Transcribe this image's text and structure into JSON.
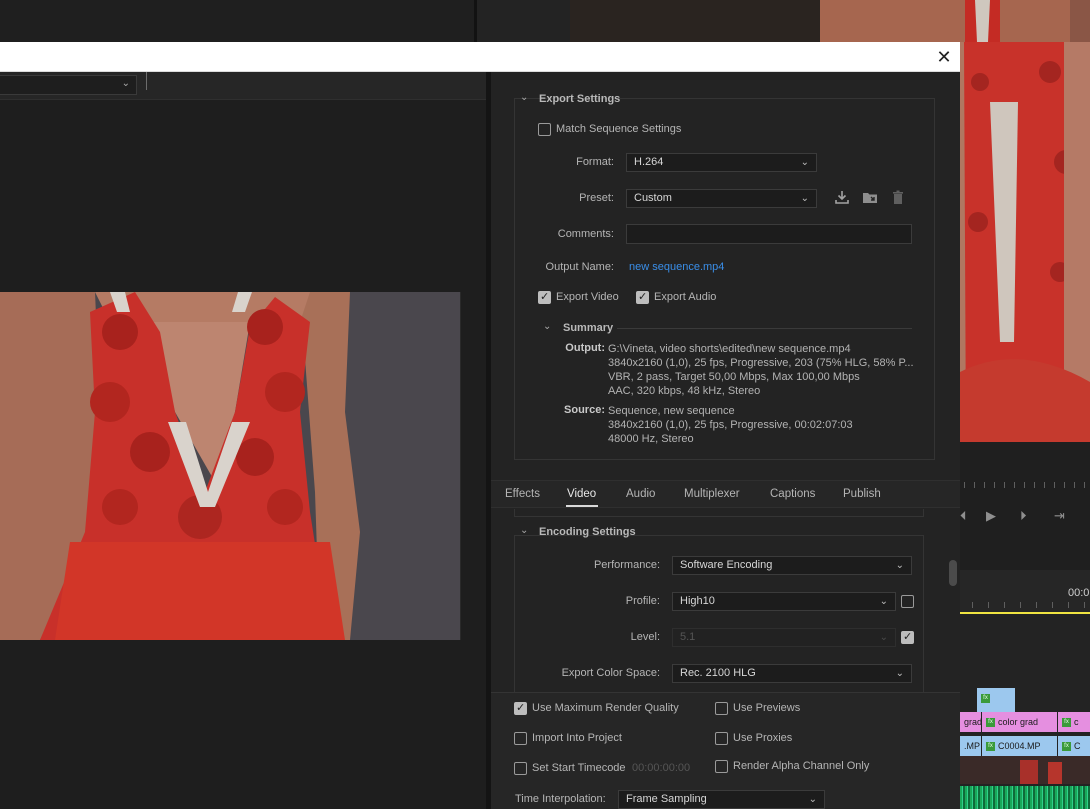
{
  "dialog": {
    "close_glyph": "✕"
  },
  "export_settings": {
    "header": "Export Settings",
    "match_sequence_label": "Match Sequence Settings",
    "match_sequence_checked": false,
    "format_label": "Format:",
    "format_value": "H.264",
    "preset_label": "Preset:",
    "preset_value": "Custom",
    "preset_icons": [
      "save-preset-icon",
      "import-preset-icon",
      "delete-preset-icon"
    ],
    "comments_label": "Comments:",
    "comments_value": "",
    "output_name_label": "Output Name:",
    "output_name_value": "new sequence.mp4",
    "export_video_label": "Export Video",
    "export_video_checked": true,
    "export_audio_label": "Export Audio",
    "export_audio_checked": true
  },
  "summary": {
    "header": "Summary",
    "output_key": "Output:",
    "output_lines": [
      "G:\\Vineta, video shorts\\edited\\new sequence.mp4",
      "3840x2160 (1,0), 25 fps, Progressive, 203 (75% HLG, 58% P...",
      "VBR, 2 pass, Target 50,00 Mbps, Max 100,00 Mbps",
      "AAC, 320 kbps, 48 kHz, Stereo"
    ],
    "source_key": "Source:",
    "source_lines": [
      "Sequence, new sequence",
      "3840x2160 (1,0), 25 fps, Progressive, 00:02:07:03",
      "48000 Hz, Stereo"
    ]
  },
  "tabs": [
    {
      "label": "Effects",
      "active": false
    },
    {
      "label": "Video",
      "active": true
    },
    {
      "label": "Audio",
      "active": false
    },
    {
      "label": "Multiplexer",
      "active": false
    },
    {
      "label": "Captions",
      "active": false
    },
    {
      "label": "Publish",
      "active": false
    }
  ],
  "encoding": {
    "header": "Encoding Settings",
    "performance_label": "Performance:",
    "performance_value": "Software Encoding",
    "profile_label": "Profile:",
    "profile_value": "High10",
    "profile_checkbox_checked": false,
    "level_label": "Level:",
    "level_value": "5.1",
    "level_checkbox_checked": true,
    "color_space_label": "Export Color Space:",
    "color_space_value": "Rec. 2100 HLG"
  },
  "bottom": {
    "use_max_render_quality_label": "Use Maximum Render Quality",
    "use_max_render_quality_checked": true,
    "use_previews_label": "Use Previews",
    "use_previews_checked": false,
    "import_into_project_label": "Import Into Project",
    "import_into_project_checked": false,
    "use_proxies_label": "Use Proxies",
    "use_proxies_checked": false,
    "set_start_timecode_label": "Set Start Timecode",
    "set_start_timecode_checked": false,
    "start_timecode_value": "00:00:00:00",
    "render_alpha_label": "Render Alpha Channel Only",
    "render_alpha_checked": false,
    "time_interpolation_label": "Time Interpolation:",
    "time_interpolation_value": "Frame Sampling"
  },
  "background_app": {
    "timeline_timecode": "00:0",
    "clip_labels": [
      "grad",
      "color grad",
      "c",
      ".MP",
      "C0004.MP",
      "C"
    ],
    "transport_icons": [
      "step-back-icon",
      "play-icon",
      "step-forward-icon",
      "insert-icon"
    ]
  },
  "colors": {
    "accent_link": "#3a8ee8",
    "playhead_line": "#f0e442",
    "clip_pink": "#e58fe0",
    "clip_blue": "#9cc8ee",
    "audio_green": "#19a85a"
  }
}
